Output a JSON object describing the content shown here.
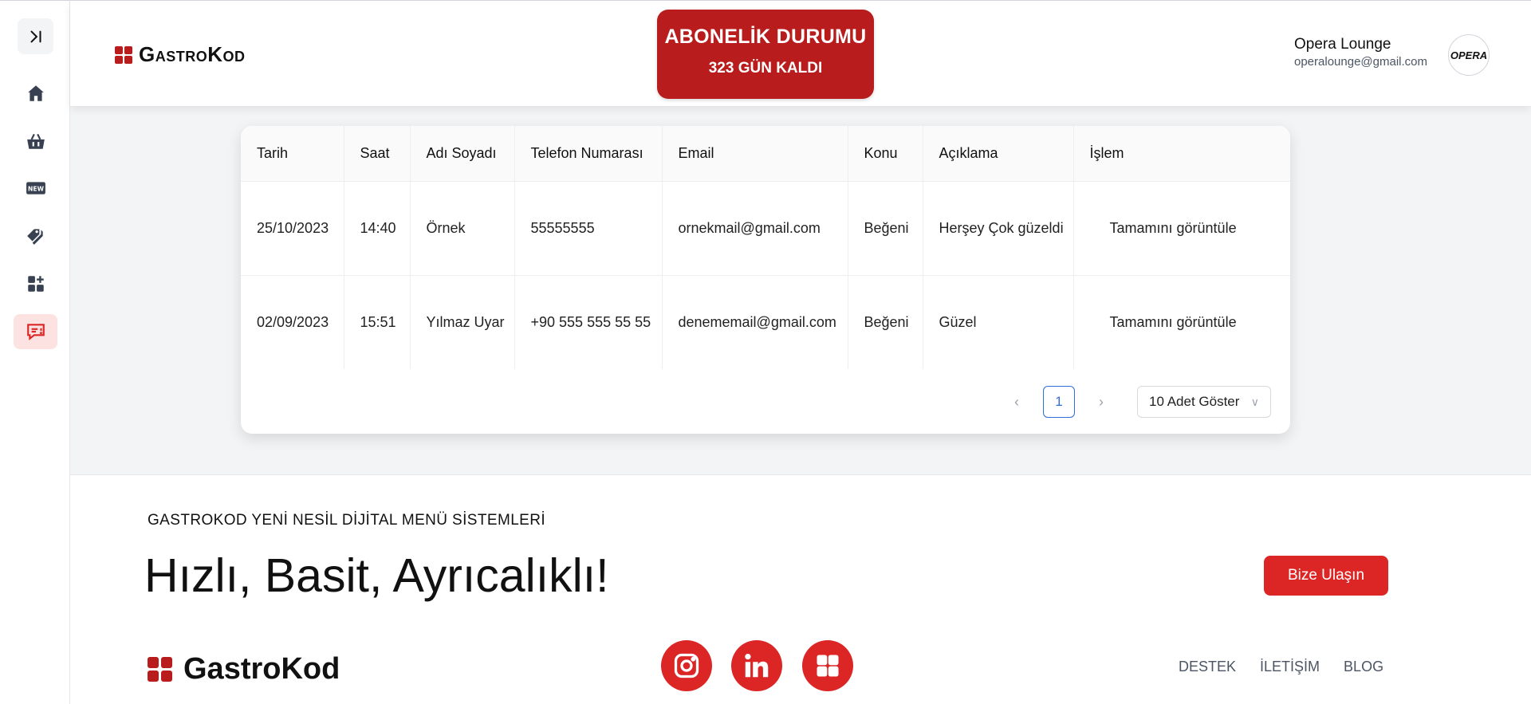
{
  "sidebar": {
    "items": [
      {
        "name": "home"
      },
      {
        "name": "basket"
      },
      {
        "name": "new"
      },
      {
        "name": "tags"
      },
      {
        "name": "apps"
      },
      {
        "name": "feedback",
        "active": true
      }
    ]
  },
  "header": {
    "brand": "GastroKod",
    "subscription": {
      "title": "ABONELİK DURUMU",
      "days": "323 GÜN KALDI"
    },
    "user": {
      "name": "Opera Lounge",
      "email": "operalounge@gmail.com",
      "avatar_text": "OPERA"
    }
  },
  "table": {
    "columns": [
      "Tarih",
      "Saat",
      "Adı Soyadı",
      "Telefon Numarası",
      "Email",
      "Konu",
      "Açıklama",
      "İşlem"
    ],
    "rows": [
      [
        "25/10/2023",
        "14:40",
        "Örnek",
        "55555555",
        "ornekmail@gmail.com",
        "Beğeni",
        "Herşey Çok güzeldi",
        "Tamamını görüntüle"
      ],
      [
        "02/09/2023",
        "15:51",
        "Yılmaz Uyar",
        "+90 555 555 55 55",
        "denememail@gmail.com",
        "Beğeni",
        "Güzel",
        "Tamamını görüntüle"
      ]
    ]
  },
  "pagination": {
    "current_page": "1",
    "page_size": "10 Adet Göster"
  },
  "footer": {
    "kicker": "GASTROKOD YENİ NESİL DİJİTAL MENÜ SİSTEMLERİ",
    "headline": "Hızlı, Basit, Ayrıcalıklı!",
    "contact_button": "Bize Ulaşın",
    "brand": "GastroKod",
    "links": [
      "DESTEK",
      "İLETİŞİM",
      "BLOG"
    ]
  },
  "colors": {
    "brand_red": "#dc2626",
    "dark_red": "#b91c1c",
    "accent_blue": "#2f6fdb"
  }
}
